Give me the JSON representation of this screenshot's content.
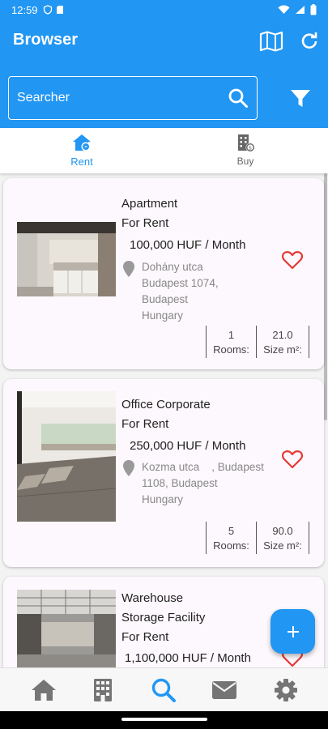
{
  "status_bar": {
    "time": "12:59"
  },
  "app_bar": {
    "title": "Browser",
    "search_placeholder": "Searcher"
  },
  "tabs": [
    {
      "label": "Rent",
      "icon": "house-rent-icon",
      "active": true
    },
    {
      "label": "Buy",
      "icon": "building-buy-icon",
      "active": false
    }
  ],
  "listings": [
    {
      "title_line1": "Apartment",
      "title_line2": "For Rent",
      "price": "100,000 HUF / Month",
      "address": [
        "Dohány utca",
        "Budapest 1074,",
        "Budapest",
        "Hungary"
      ],
      "rooms_value": "1",
      "rooms_label": "Rooms:",
      "size_value": "21.0",
      "size_label": "Size m²:"
    },
    {
      "title_line1": "Office Corporate",
      "title_line2": "For Rent",
      "price": "250,000 HUF / Month",
      "address": [
        "Kozma utca    , Budapest",
        "1108, Budapest",
        "Hungary"
      ],
      "rooms_value": "5",
      "rooms_label": "Rooms:",
      "size_value": "90.0",
      "size_label": "Size m²:"
    },
    {
      "title_line1": "Warehouse",
      "title_line2": "Storage Facility",
      "title_line3": "For Rent",
      "price": "1,100,000 HUF / Month"
    }
  ],
  "bottom_nav": [
    "home-icon",
    "building-icon",
    "search-icon",
    "mail-icon",
    "settings-icon"
  ],
  "colors": {
    "primary": "#2196f3",
    "heart": "#e53935",
    "nav_inactive": "#757575"
  }
}
